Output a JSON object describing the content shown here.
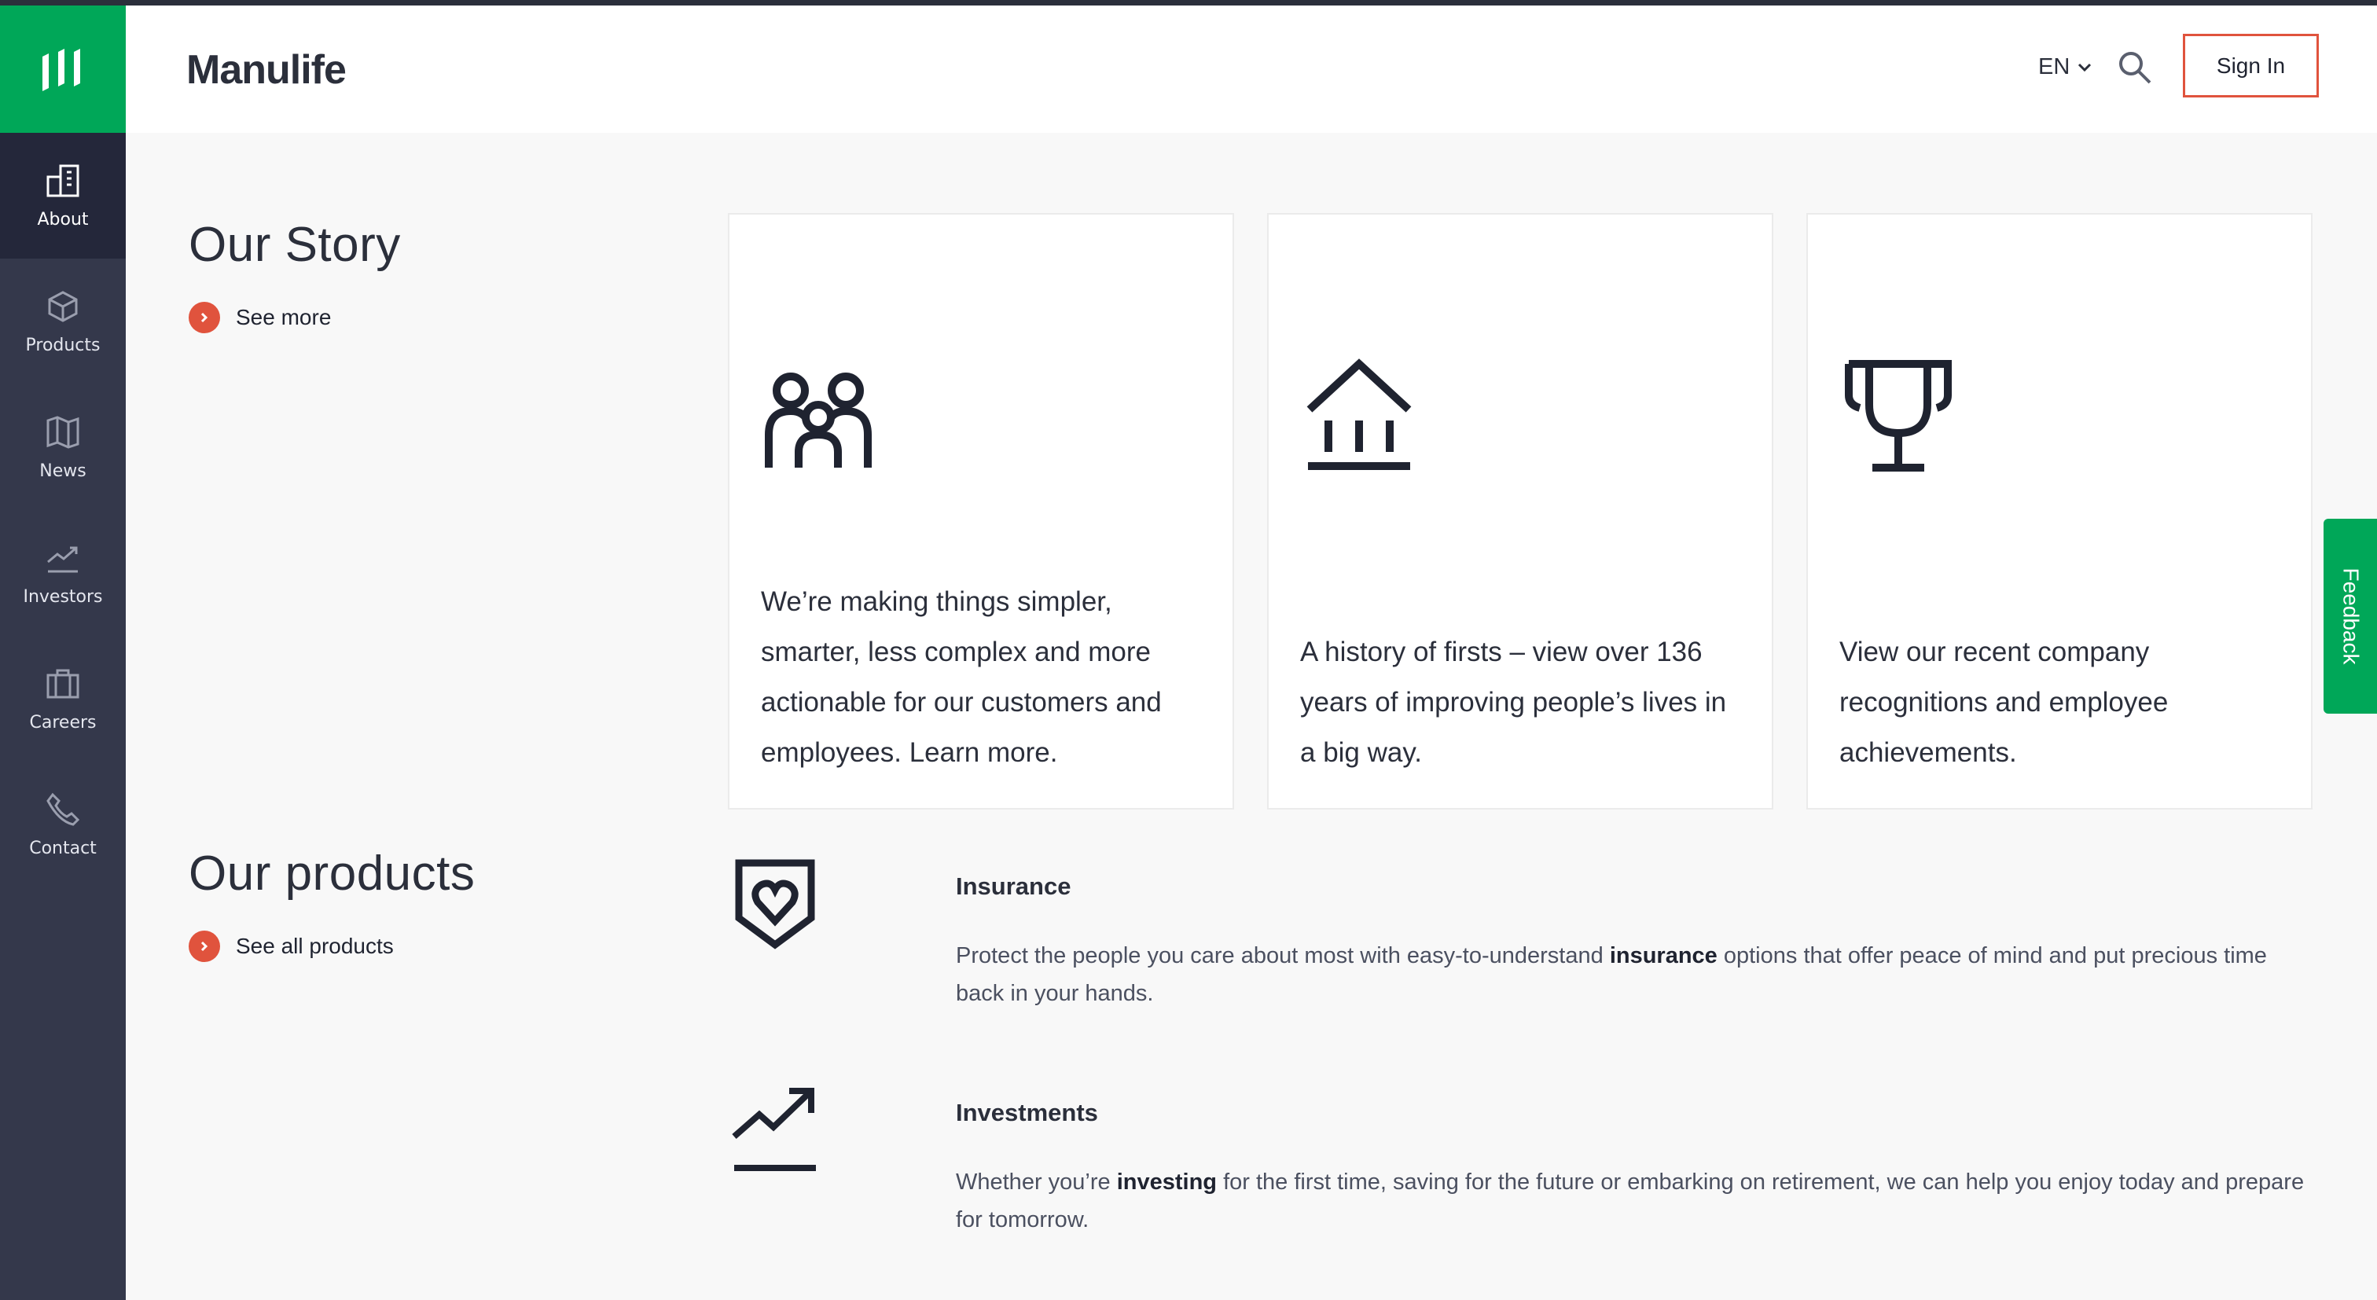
{
  "brand": {
    "name": "Manulife",
    "accent": "#00a758",
    "sidebar_bg": "#34384b",
    "cta_color": "#e0533d"
  },
  "header": {
    "language": "EN",
    "signin_label": "Sign In",
    "search_icon": "search-icon"
  },
  "sidebar": {
    "items": [
      {
        "label": "About",
        "icon": "building-icon",
        "active": true
      },
      {
        "label": "Products",
        "icon": "cube-icon"
      },
      {
        "label": "News",
        "icon": "map-icon"
      },
      {
        "label": "Investors",
        "icon": "trend-icon"
      },
      {
        "label": "Careers",
        "icon": "briefcase-icon"
      },
      {
        "label": "Contact",
        "icon": "phone-icon"
      }
    ]
  },
  "story": {
    "title": "Our Story",
    "link": "See more",
    "cards": [
      {
        "icon": "family-icon",
        "text": "We’re making things simpler, smarter, less complex and more actionable for our customers and employees. Learn more."
      },
      {
        "icon": "bank-icon",
        "text": "A history of firsts – view over 136 years of improving people’s lives in a big way."
      },
      {
        "icon": "trophy-icon",
        "text": "View our recent company recognitions and employee achievements."
      }
    ]
  },
  "products": {
    "title": "Our products",
    "link": "See all products",
    "items": [
      {
        "icon": "shield-heart-icon",
        "title": "Insurance",
        "desc_pre": "Protect the people you care about most with easy-to-understand ",
        "desc_bold": "insurance",
        "desc_post": " options that offer peace of mind and put precious time back in your hands."
      },
      {
        "icon": "investment-chart-icon",
        "title": "Investments",
        "desc_pre": "Whether you’re ",
        "desc_bold": "investing",
        "desc_post": " for the first time, saving for the future or embarking on retirement, we can help you enjoy today and prepare for tomorrow."
      }
    ]
  },
  "feedback": {
    "label": "Feedback"
  }
}
